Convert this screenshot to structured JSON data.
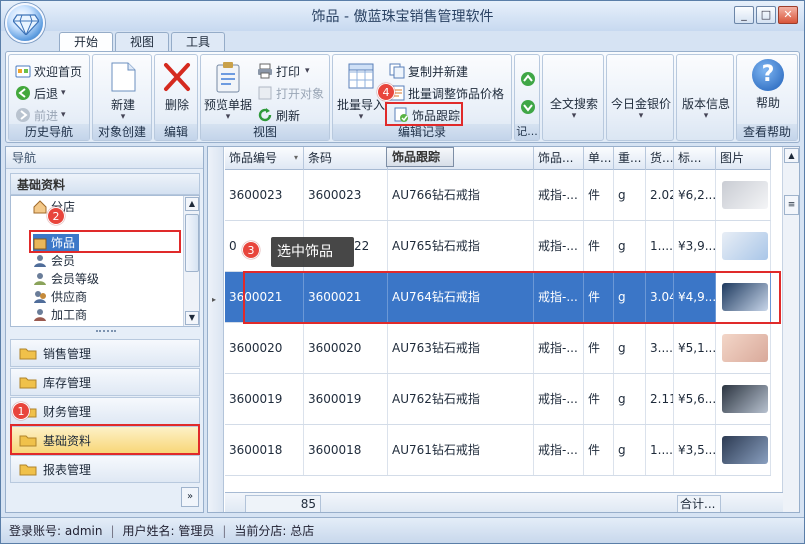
{
  "window": {
    "title": "饰品 - 傲蓝珠宝销售管理软件",
    "min": "_",
    "max": "□",
    "close": "✕"
  },
  "tabs": [
    "开始",
    "视图",
    "工具"
  ],
  "ribbon": {
    "history": {
      "label": "历史导航",
      "home": "欢迎首页",
      "back": "后退",
      "forward": "前进"
    },
    "create": {
      "label": "对象创建",
      "new": "新建"
    },
    "edit": {
      "label": "编辑",
      "delete": "删除"
    },
    "view": {
      "label": "视图",
      "preview": "预览单据",
      "print": "打印",
      "open": "打开对象",
      "refresh": "刷新"
    },
    "records": {
      "label": "编辑记录",
      "import": "批量导入",
      "copy": "复制并新建",
      "adjust": "批量调整饰品价格",
      "track": "饰品跟踪"
    },
    "rec": {
      "label": "记..."
    },
    "search": "全文搜索",
    "gold": "今日金银价",
    "version": "版本信息",
    "help": {
      "label": "查看帮助",
      "button": "帮助",
      "glyph": "?"
    }
  },
  "nav": {
    "header": "导航",
    "section": "基础资料",
    "tree": [
      "分店",
      "饰品",
      "会员",
      "会员等级",
      "供应商",
      "加工商"
    ],
    "buttons": [
      "销售管理",
      "库存管理",
      "财务管理",
      "基础资料",
      "报表管理"
    ],
    "more": "»"
  },
  "grid": {
    "columns": [
      "饰品编号",
      "条码",
      "饰品跟踪",
      "饰品...",
      "单...",
      "重...",
      "货...",
      "标...",
      "图片"
    ],
    "rows": [
      {
        "id": "3600023",
        "code": "3600023",
        "name": "AU766钻石戒指",
        "cat": "戒指-...",
        "unit": "件",
        "w": "g",
        "g": "2.02",
        "price": "¥6,2..."
      },
      {
        "id": "",
        "code": "",
        "name": "AU765钻石戒指",
        "cat": "戒指-...",
        "unit": "件",
        "w": "g",
        "g": "1....",
        "price": "¥3,9..."
      },
      {
        "id": "3600021",
        "code": "3600021",
        "name": "AU764钻石戒指",
        "cat": "戒指-...",
        "unit": "件",
        "w": "g",
        "g": "3.04",
        "price": "¥4,9..."
      },
      {
        "id": "3600020",
        "code": "3600020",
        "name": "AU763钻石戒指",
        "cat": "戒指-...",
        "unit": "件",
        "w": "g",
        "g": "3....",
        "price": "¥5,1..."
      },
      {
        "id": "3600019",
        "code": "3600019",
        "name": "AU762钻石戒指",
        "cat": "戒指-...",
        "unit": "件",
        "w": "g",
        "g": "2.11",
        "price": "¥5,6..."
      },
      {
        "id": "3600018",
        "code": "3600018",
        "name": "AU761钻石戒指",
        "cat": "戒指-...",
        "unit": "件",
        "w": "g",
        "g": "1....",
        "price": "¥3,5..."
      }
    ],
    "partial_row_code": "22",
    "partial_row_id": "0",
    "count": "85",
    "sum": "合计...",
    "tooltip": "饰品跟踪"
  },
  "annotations": {
    "b1": "1",
    "b2": "2",
    "b3": "3",
    "b4": "4",
    "tip3": "选中饰品"
  },
  "status": {
    "account": "登录账号: admin",
    "user": "用户姓名: 管理员",
    "branch": "当前分店: 总店"
  }
}
